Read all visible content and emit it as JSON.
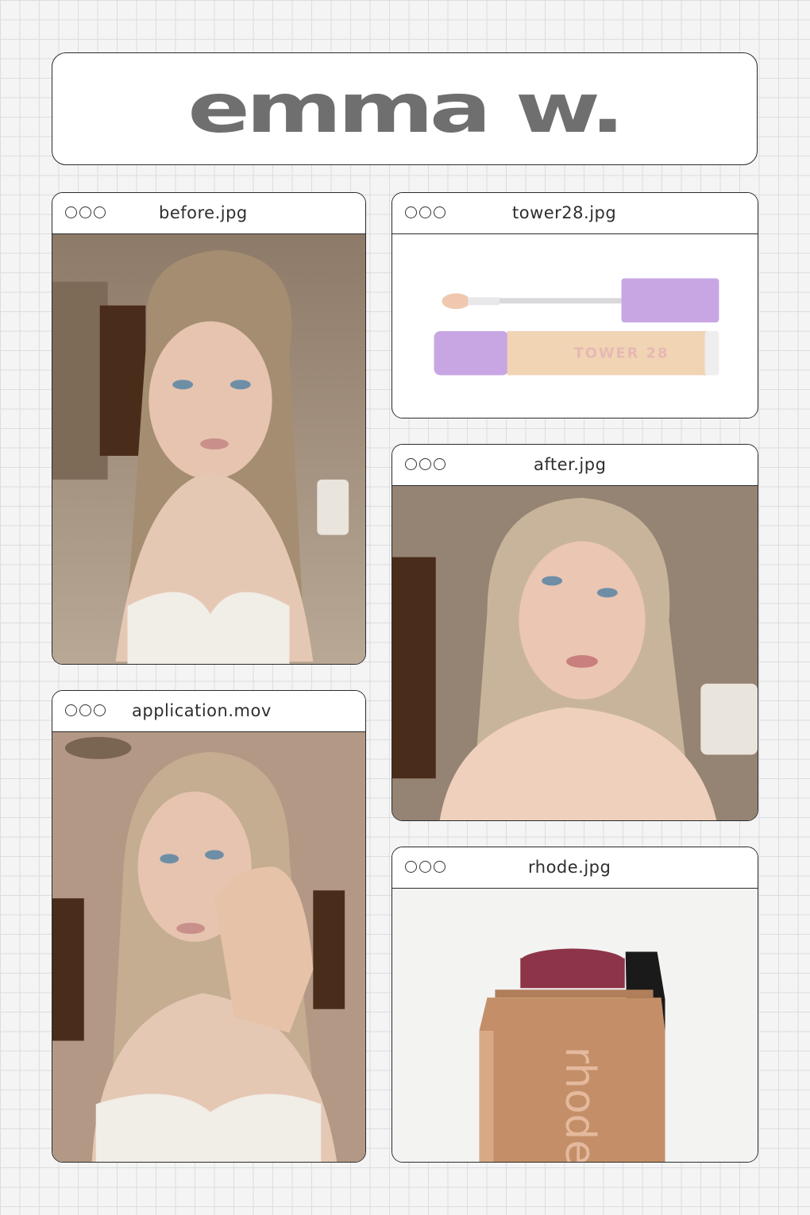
{
  "title": "emma w.",
  "windows": {
    "before": {
      "filename": "before.jpg"
    },
    "tower28": {
      "filename": "tower28.jpg",
      "product_text": "TOWER 28"
    },
    "after": {
      "filename": "after.jpg"
    },
    "application": {
      "filename": "application.mov"
    },
    "rhode": {
      "filename": "rhode.jpg",
      "product_text": "rhode"
    }
  },
  "colors": {
    "grid_background": "#f4f4f5",
    "title_text": "#6f6f6f",
    "window_border": "#2a2a2a",
    "tube_cap": "#c8a6e3",
    "rhode_stick": "#c48f68",
    "rhode_balm": "#8e3448"
  }
}
